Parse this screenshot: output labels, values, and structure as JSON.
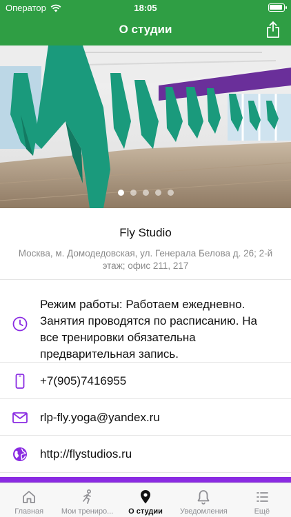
{
  "status_bar": {
    "carrier": "Оператор",
    "time": "18:05"
  },
  "nav": {
    "title": "О студии"
  },
  "carousel": {
    "page_count": 5,
    "active_index": 0
  },
  "studio": {
    "name": "Fly Studio",
    "address": "Москва, м. Домодедовская, ул. Генерала Белова д. 26; 2-й этаж; офис 211, 217"
  },
  "contacts": {
    "hours": "Режим работы: Работаем ежедневно. Занятия проводятся по расписанию. На все тренировки обязательна предварительная запись.",
    "phone": "+7(905)7416955",
    "email": "rlp-fly.yoga@yandex.ru",
    "website": "http://flystudios.ru"
  },
  "tabbar": {
    "items": [
      {
        "label": "Главная",
        "icon": "home-icon"
      },
      {
        "label": "Мои трениро...",
        "icon": "workout-icon"
      },
      {
        "label": "О студии",
        "icon": "location-pin-icon"
      },
      {
        "label": "Уведомления",
        "icon": "bell-icon"
      },
      {
        "label": "Ещё",
        "icon": "more-list-icon"
      }
    ],
    "active_index": 2
  },
  "colors": {
    "header_green": "#2f9e44",
    "accent_purple": "#8a2be2",
    "hammock_teal": "#1a9a7c"
  }
}
